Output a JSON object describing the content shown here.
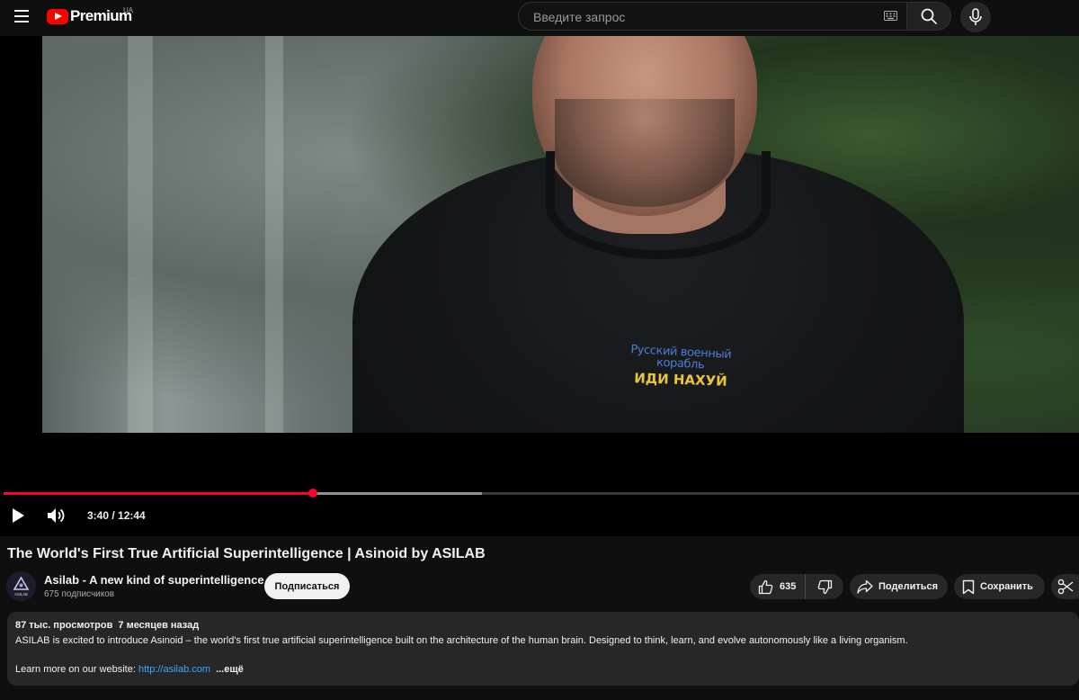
{
  "header": {
    "logo_text": "Premium",
    "region": "UA",
    "search_placeholder": "Введите запрос",
    "icons": [
      "menu-icon",
      "youtube-logo-icon",
      "keyboard-icon",
      "search-icon",
      "microphone-icon"
    ]
  },
  "player": {
    "shirt_text_line1": "Русский военный корабль",
    "shirt_text_line2": "ИДИ НАХУЙ",
    "current_time": "3:40",
    "duration": "12:44",
    "time_display": "3:40 / 12:44",
    "played_fraction": 0.288,
    "buffered_fraction": 0.4447,
    "accent_color": "#ff0033",
    "icons": [
      "play-icon",
      "volume-icon"
    ]
  },
  "video": {
    "title": "The World's First True Artificial Superintelligence | Asinoid by ASILAB"
  },
  "channel": {
    "name": "Asilab - A new kind of superintelligence",
    "subscribers": "675 подписчиков",
    "avatar_label": "ASILAB",
    "subscribe_label": "Подписаться"
  },
  "actions": {
    "like_count": "635",
    "share_label": "Поделиться",
    "save_label": "Сохранить",
    "icons": [
      "thumbs-up-icon",
      "thumbs-down-icon",
      "share-icon",
      "save-icon",
      "scissors-icon"
    ]
  },
  "description": {
    "views": "87 тыс. просмотров",
    "age": "7 месяцев назад",
    "text": "ASILAB is excited to introduce Asinoid – the world's first true artificial superintelligence built on the architecture of the human brain. Designed to think, learn, and evolve autonomously like a living organism.",
    "link_prefix": "Learn more on our website: ",
    "link": "http://asilab.com",
    "more_label": "...ещё"
  }
}
